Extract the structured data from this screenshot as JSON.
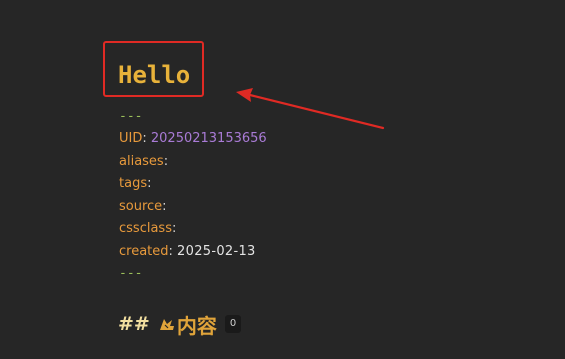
{
  "note": {
    "title": "Hello",
    "frontmatter": {
      "open_delimiter": "---",
      "close_delimiter": "---",
      "fields": [
        {
          "key": "UID",
          "value": "20250213153656"
        },
        {
          "key": "aliases",
          "value": ""
        },
        {
          "key": "tags",
          "value": ""
        },
        {
          "key": "source",
          "value": ""
        },
        {
          "key": "cssclass",
          "value": ""
        },
        {
          "key": "created",
          "value": "2025-02-13"
        }
      ]
    },
    "heading": {
      "marker": "##",
      "icon": "pen-icon",
      "text": "内容",
      "count": "0"
    }
  },
  "annotation": {
    "box_color": "#e02a24",
    "arrow_color": "#e02a24"
  },
  "colors": {
    "background": "#262626",
    "title": "#e8b23a",
    "frontmatter_key": "#e89a3c",
    "uid_value": "#a97bd6",
    "delimiter": "#9bbf5a"
  }
}
